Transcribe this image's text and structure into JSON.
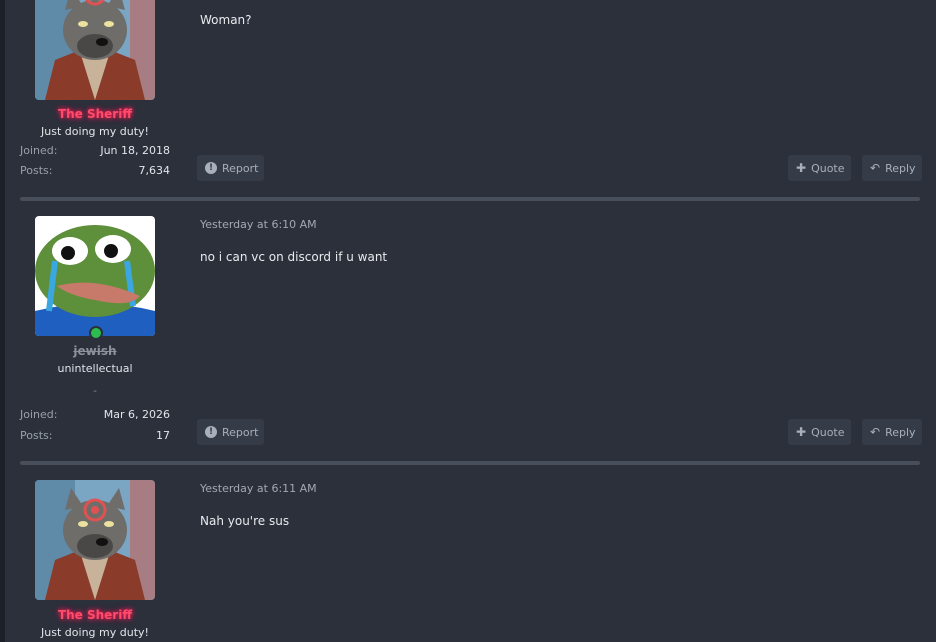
{
  "posts": [
    {
      "username": "The Sheriff",
      "user_title": "Just doing my duty!",
      "joined_label": "Joined:",
      "joined_value": "Jun 18, 2018",
      "posts_label": "Posts:",
      "posts_value": "7,634",
      "message": "Woman?",
      "report_label": "Report",
      "quote_label": "Quote",
      "reply_label": "Reply"
    },
    {
      "date": "Yesterday at 6:10 AM",
      "username": "jewish",
      "user_title": "unintellectual",
      "dash": "-",
      "online": true,
      "joined_label": "Joined:",
      "joined_value": "Mar 6, 2026",
      "posts_label": "Posts:",
      "posts_value": "17",
      "message": "no i can vc on discord if u want",
      "report_label": "Report",
      "quote_label": "Quote",
      "reply_label": "Reply"
    },
    {
      "date": "Yesterday at 6:11 AM",
      "username": "The Sheriff",
      "user_title": "Just doing my duty!",
      "message": "Nah you're sus"
    }
  ],
  "colors": {
    "background": "#2b303b",
    "sheriff_name": "#ff4c6a",
    "online": "#2bbd4f",
    "button_bg": "#353b47"
  },
  "icons": {
    "report": "exclamation-circle-icon",
    "quote": "plus-icon",
    "reply": "reply-arrow-icon"
  }
}
